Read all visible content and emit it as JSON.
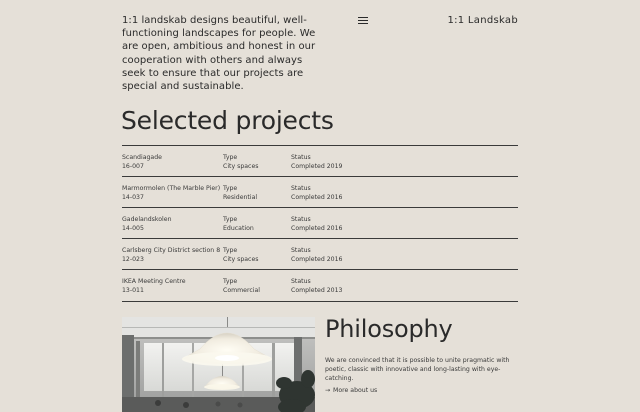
{
  "header": {
    "intro": "1:1 landskab designs beautiful, well-functioning landscapes for people. We are open, ambitious and honest in our cooperation with others and always seek to ensure that our projects are special and sustainable.",
    "logo": "1:1  Landskab",
    "menu_icon": "hamburger-menu-icon"
  },
  "projects": {
    "title": "Selected projects",
    "type_label": "Type",
    "status_label": "Status",
    "rows": [
      {
        "name": "Scandiagade",
        "code": "16-007",
        "type": "City spaces",
        "status": "Completed 2019"
      },
      {
        "name": "Marmormolen (The Marble Pier)",
        "code": "14-037",
        "type": "Residential",
        "status": "Completed 2016"
      },
      {
        "name": "Gadelandskolen",
        "code": "14-005",
        "type": "Education",
        "status": "Completed 2016"
      },
      {
        "name": "Carlsberg City District section 8",
        "code": "12-023",
        "type": "City spaces",
        "status": "Completed 2016"
      },
      {
        "name": "IKEA Meeting Centre",
        "code": "13-011",
        "type": "Commercial",
        "status": "Completed 2013"
      }
    ]
  },
  "philosophy": {
    "title": "Philosophy",
    "text": "We are convinced that it is possible to unite pragmatic with poetic, classic with innovative and long-lasting with eye-catching.",
    "link_arrow": "→",
    "link_label": "More about us",
    "image": "interior-with-pendant-lamps-photo"
  }
}
